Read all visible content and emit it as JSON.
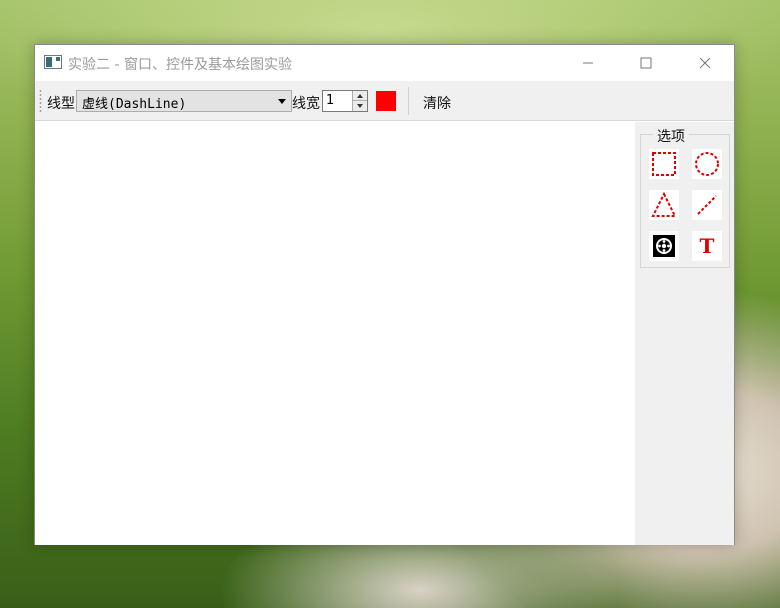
{
  "window": {
    "title": "实验二 - 窗口、控件及基本绘图实验"
  },
  "toolbar": {
    "line_style_label": "线型",
    "line_style_value": "虚线(DashLine)",
    "line_width_label": "线宽",
    "line_width_value": "1",
    "pen_color": "#ff0000",
    "clear_label": "清除"
  },
  "side_panel": {
    "group_title": "选项",
    "tools": [
      {
        "name": "rectangle",
        "icon": "dashed-rectangle-icon"
      },
      {
        "name": "ellipse",
        "icon": "dashed-circle-icon"
      },
      {
        "name": "triangle",
        "icon": "dashed-triangle-icon"
      },
      {
        "name": "line",
        "icon": "dashed-line-icon"
      },
      {
        "name": "image",
        "icon": "image-stamp-icon"
      },
      {
        "name": "text",
        "icon": "text-icon",
        "glyph": "T"
      }
    ]
  },
  "colors": {
    "accent": "#ff0000",
    "toolbar_bg": "#f0f0f0",
    "canvas_bg": "#ffffff"
  }
}
